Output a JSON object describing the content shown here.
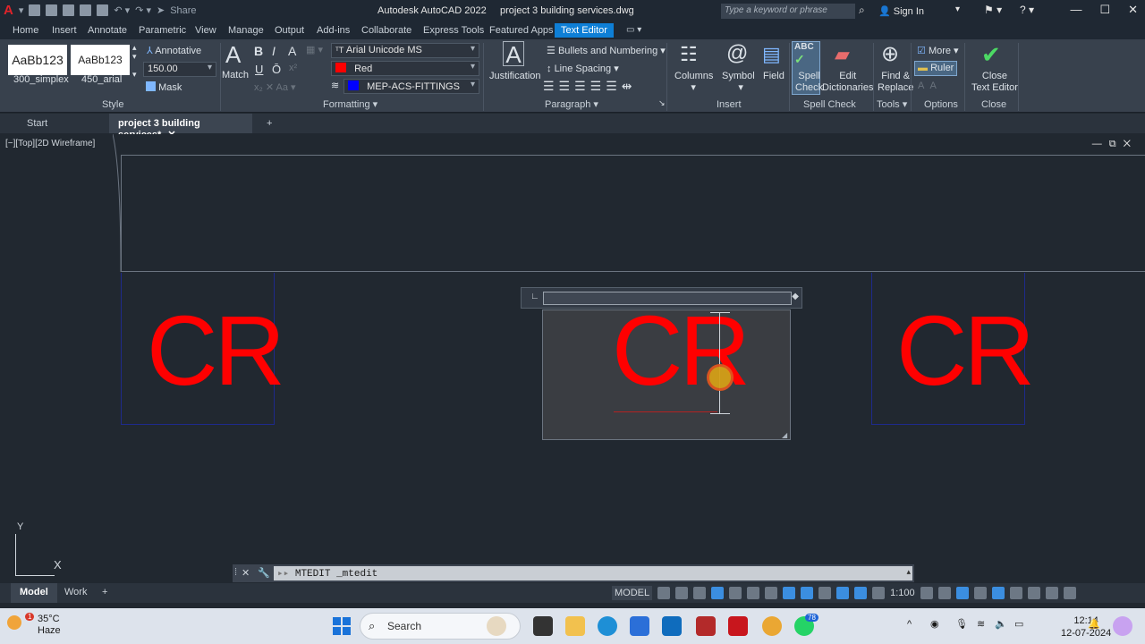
{
  "titlebar": {
    "app_title": "Autodesk AutoCAD 2022",
    "file_title": "project 3 building services.dwg",
    "share_label": "Share",
    "search_placeholder": "Type a keyword or phrase",
    "signin_label": "Sign In"
  },
  "menu": [
    "Home",
    "Insert",
    "Annotate",
    "Parametric",
    "View",
    "Manage",
    "Output",
    "Add-ins",
    "Collaborate",
    "Express Tools",
    "Featured Apps"
  ],
  "menu_active": "Text Editor",
  "ribbon": {
    "style": {
      "samples": [
        {
          "preview": "AaBb123",
          "name": "300_simplex"
        },
        {
          "preview": "AaBb123",
          "name": "450_arial"
        }
      ],
      "annotative_label": "Annotative",
      "height_value": "150.00",
      "mask_label": "Mask",
      "panel_label": "Style"
    },
    "formatting": {
      "match_label": "Match",
      "bold": "B",
      "italic": "I",
      "strike": "A",
      "underline": "U",
      "overline": "Ō",
      "font_value": "Arial Unicode MS",
      "color_value": "Red",
      "color_hex": "#ff0000",
      "layer_value": "MEP-ACS-FITTINGS",
      "layer_hex": "#0000ff",
      "panel_label": "Formatting"
    },
    "paragraph": {
      "justification_label": "Justification",
      "bullets_label": "Bullets and Numbering",
      "line_spacing_label": "Line Spacing",
      "panel_label": "Paragraph"
    },
    "insert": {
      "columns_label": "Columns",
      "symbol_label": "Symbol",
      "field_label": "Field",
      "panel_label": "Insert"
    },
    "spell": {
      "spell_label_1": "Spell",
      "spell_label_2": "Check",
      "edit_label_1": "Edit",
      "edit_label_2": "Dictionaries",
      "panel_label": "Spell Check"
    },
    "tools": {
      "find_label_1": "Find &",
      "find_label_2": "Replace",
      "panel_label": "Tools"
    },
    "options": {
      "more_label": "More",
      "ruler_label": "Ruler",
      "panel_label": "Options"
    },
    "close": {
      "close_label_1": "Close",
      "close_label_2": "Text Editor",
      "panel_label": "Close"
    }
  },
  "doctabs": {
    "start": "Start",
    "active": "project 3 building services*",
    "add": "+"
  },
  "viewport": {
    "label": "[−][Top][2D Wireframe]",
    "texts": [
      "CR",
      "CR",
      "CR"
    ],
    "ucs_x": "X",
    "ucs_y": "Y"
  },
  "command": {
    "text": "MTEDIT _mtedit"
  },
  "status": {
    "layouts": [
      "Model",
      "Work"
    ],
    "add": "+",
    "model_label": "MODEL",
    "scale": "1:100"
  },
  "taskbar": {
    "temperature": "35°C",
    "condition": "Haze",
    "search_label": "Search",
    "badge": "78",
    "time": "12:14",
    "date": "12-07-2024",
    "weather_badge": "1"
  }
}
